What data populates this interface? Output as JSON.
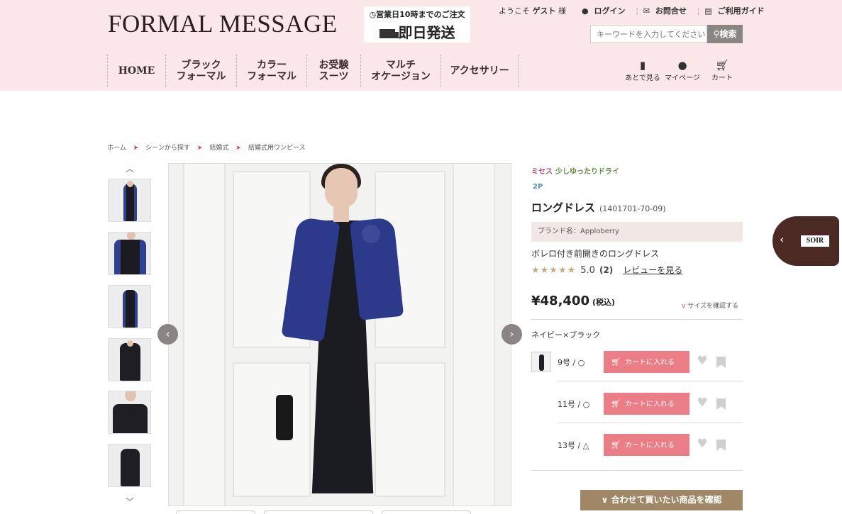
{
  "header": {
    "logo": "FORMAL MESSAGE",
    "shipping_note": "営業日10時までのご注文",
    "shipping_main": "即日発送",
    "welcome_prefix": "ようこそ",
    "welcome_user": "ゲスト",
    "welcome_suffix": "様",
    "links": {
      "login": "ログイン",
      "contact": "お問合せ",
      "guide": "ご利用ガイド"
    },
    "search": {
      "placeholder": "キーワードを入力してください",
      "button": "検索"
    },
    "nav": [
      "HOME",
      "ブラック\nフォーマル",
      "カラー\nフォーマル",
      "お受験\nスーツ",
      "マルチ\nオケージョン",
      "アクセサリー"
    ],
    "icons": {
      "later": "あとで見る",
      "mypage": "マイページ",
      "cart": "カート"
    },
    "icon_names": [
      "bookmark-icon",
      "user-icon",
      "cart-icon",
      "clock-icon",
      "truck-icon",
      "mail-icon",
      "book-icon",
      "search-icon"
    ]
  },
  "breadcrumb": [
    "ホーム",
    "シーンから探す",
    "結婚式",
    "結婚式用ワンピース"
  ],
  "product": {
    "tag_misses": "ミセス",
    "tag_style": "少しゆったりドライ",
    "tag_pieces": "2P",
    "title": "ロングドレス",
    "code": "(1401701-70-09)",
    "brand": "ブランド名：Apploberry",
    "description": "ボレロ付き前開きのロングドレス",
    "stars": "★★★★★",
    "rating": "5.0",
    "review_count": "(2)",
    "review_link": "レビューを見る",
    "price": "¥48,400",
    "tax": "(税込)",
    "size_check": "サイズを確認する",
    "color": "ネイビー×ブラック",
    "sizes": [
      {
        "label": "9号 / ○",
        "cart": "カートに入れる"
      },
      {
        "label": "11号 / ○",
        "cart": "カートに入れる"
      },
      {
        "label": "13号 / △",
        "cart": "カートに入れる"
      }
    ],
    "related_button": "合わせて買いたい商品を確認"
  },
  "side_tab": {
    "logo": "SOIR"
  },
  "colors": {
    "header_bg": "#fbe7e8",
    "cart_button": "#ea7d86",
    "related_button": "#a08866",
    "side_tab": "#4a2a22"
  }
}
